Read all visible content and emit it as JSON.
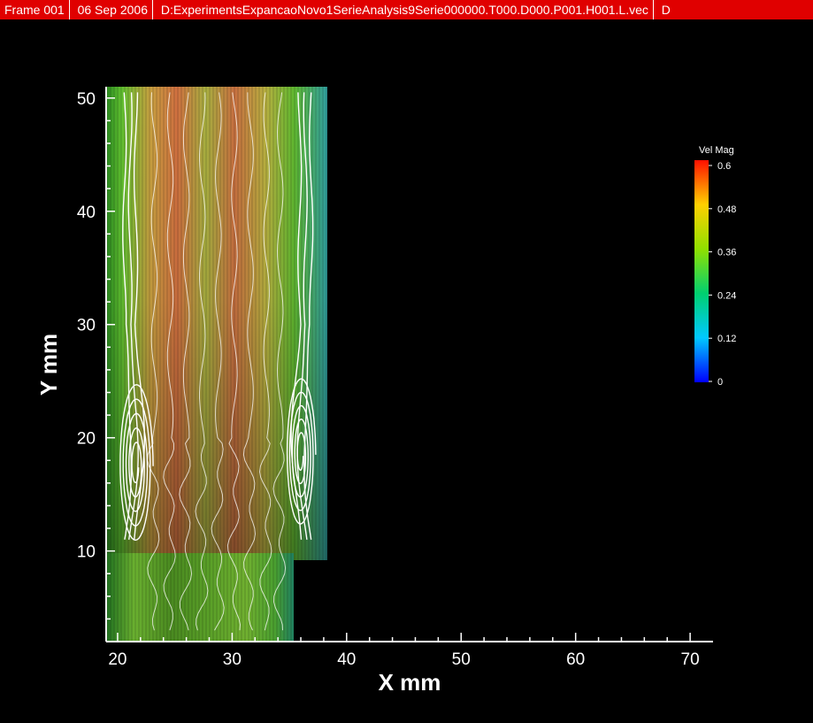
{
  "header": {
    "frame": "Frame 001",
    "date": "06 Sep 2006",
    "file": "D:ExperimentsExpancaoNovo1SerieAnalysis9Serie000000.T000.D000.P001.H001.L.vec",
    "extra": "D"
  },
  "chart_data": {
    "type": "heatmap",
    "xlabel": "X mm",
    "ylabel": "Y mm",
    "xlim": [
      19,
      72
    ],
    "ylim": [
      2,
      51
    ],
    "xticks": [
      "20",
      "30",
      "40",
      "50",
      "60",
      "70"
    ],
    "yticks": [
      "10",
      "20",
      "30",
      "40",
      "50"
    ],
    "colorbar": {
      "title": "Vel Mag",
      "min": 0,
      "max": 0.6,
      "ticks": [
        "0",
        "0.12",
        "0.24",
        "0.36",
        "0.48",
        "0.6"
      ]
    },
    "colors": {
      "background": "#000000",
      "axis": "#ffffff",
      "streamline": "#ffffff",
      "header": "#e00000"
    }
  }
}
